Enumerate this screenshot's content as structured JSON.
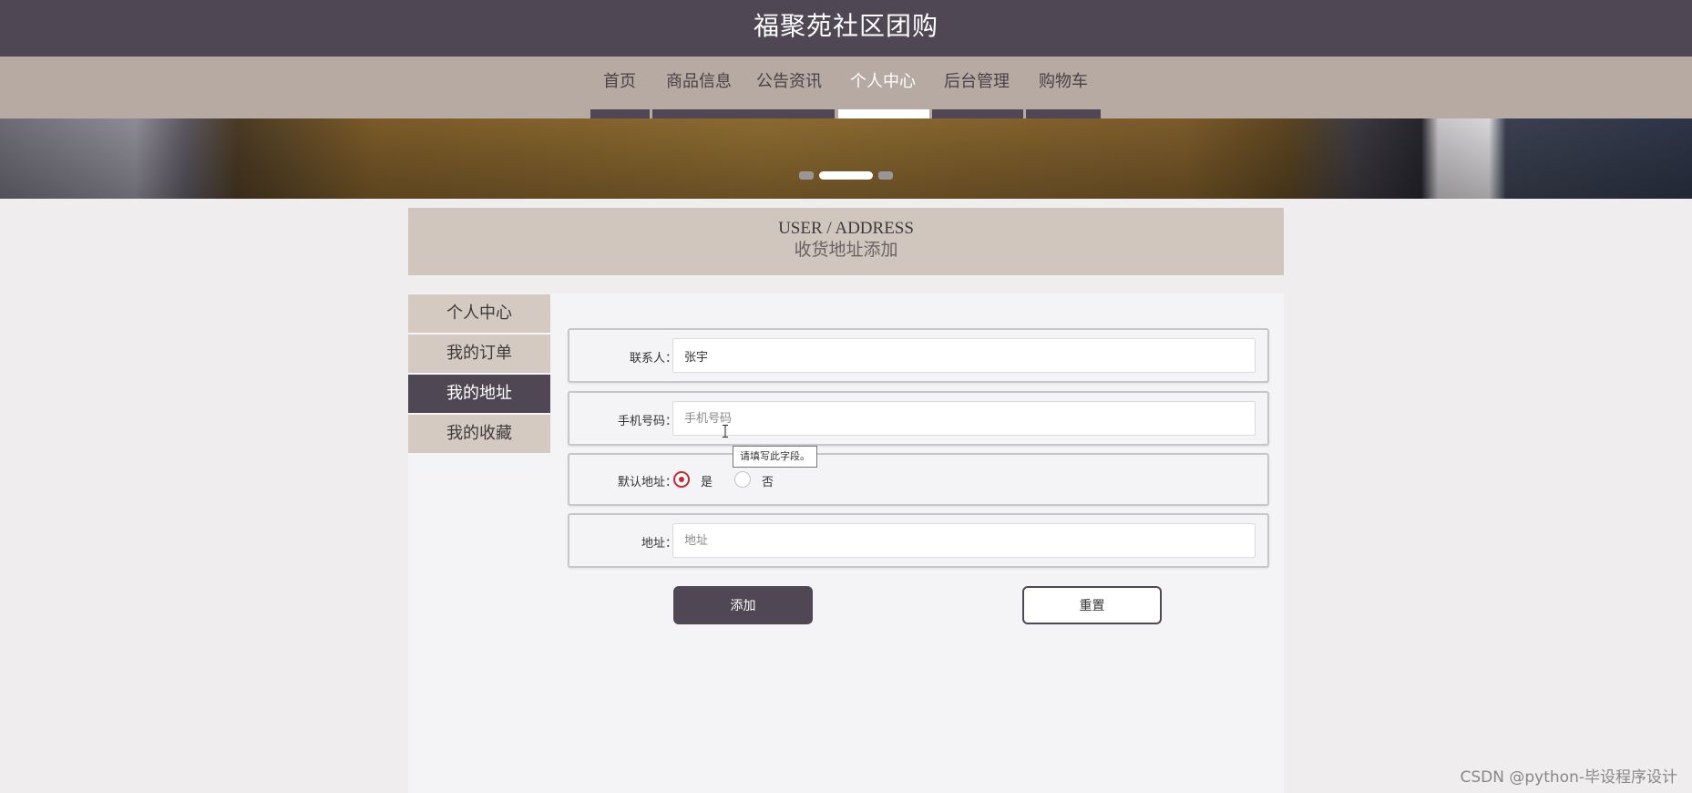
{
  "header": {
    "title": "福聚苑社区团购"
  },
  "nav": {
    "items": [
      {
        "label": "首页"
      },
      {
        "label": "商品信息"
      },
      {
        "label": "公告资讯"
      },
      {
        "label": "个人中心",
        "active": true
      },
      {
        "label": "后台管理"
      },
      {
        "label": "购物车"
      }
    ]
  },
  "banner": {
    "slide_count": 3,
    "active_index": 1
  },
  "page": {
    "title_en": "USER / ADDRESS",
    "title_cn": "收货地址添加"
  },
  "sidebar": {
    "items": [
      {
        "label": "个人中心"
      },
      {
        "label": "我的订单"
      },
      {
        "label": "我的地址",
        "active": true
      },
      {
        "label": "我的收藏"
      }
    ]
  },
  "form": {
    "contact": {
      "label": "联系人：",
      "value": "张宇"
    },
    "phone": {
      "label": "手机号码：",
      "value": "",
      "placeholder": "手机号码",
      "validation_tooltip": "请填写此字段。"
    },
    "default_address": {
      "label": "默认地址：",
      "options": [
        {
          "label": "是",
          "checked": true
        },
        {
          "label": "否",
          "checked": false
        }
      ]
    },
    "address": {
      "label": "地址：",
      "value": "",
      "placeholder": "地址"
    },
    "submit_label": "添加",
    "reset_label": "重置"
  },
  "watermark": "CSDN @python-毕设程序设计",
  "colors": {
    "header_bg": "#4f4854",
    "nav_bg": "#b6aaa3",
    "title_bar_bg": "#d0c6bd",
    "sidebar_bg": "#d4cac2",
    "accent_dark": "#4f4854",
    "radio_checked": "#c9242f"
  }
}
